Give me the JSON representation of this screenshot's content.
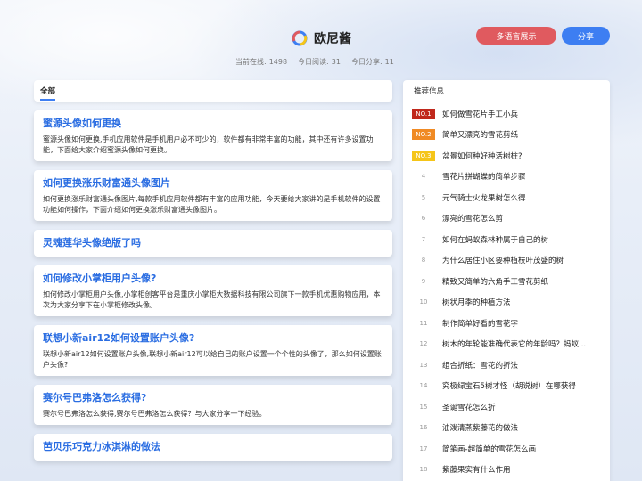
{
  "header": {
    "site_name": "欧尼酱",
    "lang_button": "多语言展示",
    "share_button": "分享",
    "stats": {
      "online_label": "当前在线:",
      "online_value": "1498",
      "today_read_label": "今日阅读:",
      "today_read_value": "31",
      "today_share_label": "今日分享:",
      "today_share_value": "11"
    }
  },
  "tabs": {
    "all_label": "全部"
  },
  "articles": [
    {
      "title": "蜜源头像如何更换",
      "desc": "蜜源头像如何更换,手机应用软件是手机用户必不可少的，软件都有非常丰富的功能，其中还有许多设置功能，下面给大家介绍蜜源头像如何更换。"
    },
    {
      "title": "如何更换涨乐财富通头像图片",
      "desc": "如何更换涨乐财富通头像图片,每款手机应用软件都有丰富的应用功能，今天要给大家讲的是手机软件的设置功能如何操作，下面介绍如何更换涨乐财富通头像图片。"
    },
    {
      "title": "灵魂莲华头像绝版了吗",
      "desc": ""
    },
    {
      "title": "如何修改小掌柜用户头像?",
      "desc": "如何修改小掌柜用户头像,小掌柜创客平台是重庆小掌柜大数据科技有限公司旗下一款手机优惠购物应用，本次为大家分享下在小掌柜修改头像。"
    },
    {
      "title": "联想小新air12如何设置账户头像?",
      "desc": "联想小新air12如何设置账户头像,联想小新air12可以给自己的账户设置一个个性的头像了，那么如何设置账户头像?"
    },
    {
      "title": "赛尔号巴弗洛怎么获得?",
      "desc": "赛尔号巴弗洛怎么获得,赛尔号巴弗洛怎么获得？与大家分享一下经验。"
    },
    {
      "title": "芭贝乐巧克力冰淇淋的做法",
      "desc": ""
    }
  ],
  "recommend": {
    "title": "推荐信息",
    "items": [
      {
        "rank": "NO.1",
        "text": "如何做雪花片手工小兵"
      },
      {
        "rank": "NO.2",
        "text": "简单又漂亮的雪花剪纸"
      },
      {
        "rank": "NO.3",
        "text": "盆景如何种好种活树桩?"
      },
      {
        "rank": "4",
        "text": "雪花片拼蝴蝶的简单步骤"
      },
      {
        "rank": "5",
        "text": "元气骑士火龙果树怎么得"
      },
      {
        "rank": "6",
        "text": "漂亮的雪花怎么剪"
      },
      {
        "rank": "7",
        "text": "如何在蚂蚁森林种属于自己的树"
      },
      {
        "rank": "8",
        "text": "为什么居住小区要种植枝叶茂盛的树"
      },
      {
        "rank": "9",
        "text": "精致又简单的六角手工雪花剪纸"
      },
      {
        "rank": "10",
        "text": "树状月季的种植方法"
      },
      {
        "rank": "11",
        "text": "制作简单好看的雪花字"
      },
      {
        "rank": "12",
        "text": "树木的年轮能准确代表它的年龄吗？蚂蚁..."
      },
      {
        "rank": "13",
        "text": "组合折纸：雪花的折法"
      },
      {
        "rank": "14",
        "text": "究极绿宝石5树才怪（胡说树）在哪获得"
      },
      {
        "rank": "15",
        "text": "圣诞雪花怎么折"
      },
      {
        "rank": "16",
        "text": "油泼清蒸紫藤花的做法"
      },
      {
        "rank": "17",
        "text": "简笔画-超简单的雪花怎么画"
      },
      {
        "rank": "18",
        "text": "紫藤果实有什么作用"
      }
    ]
  }
}
